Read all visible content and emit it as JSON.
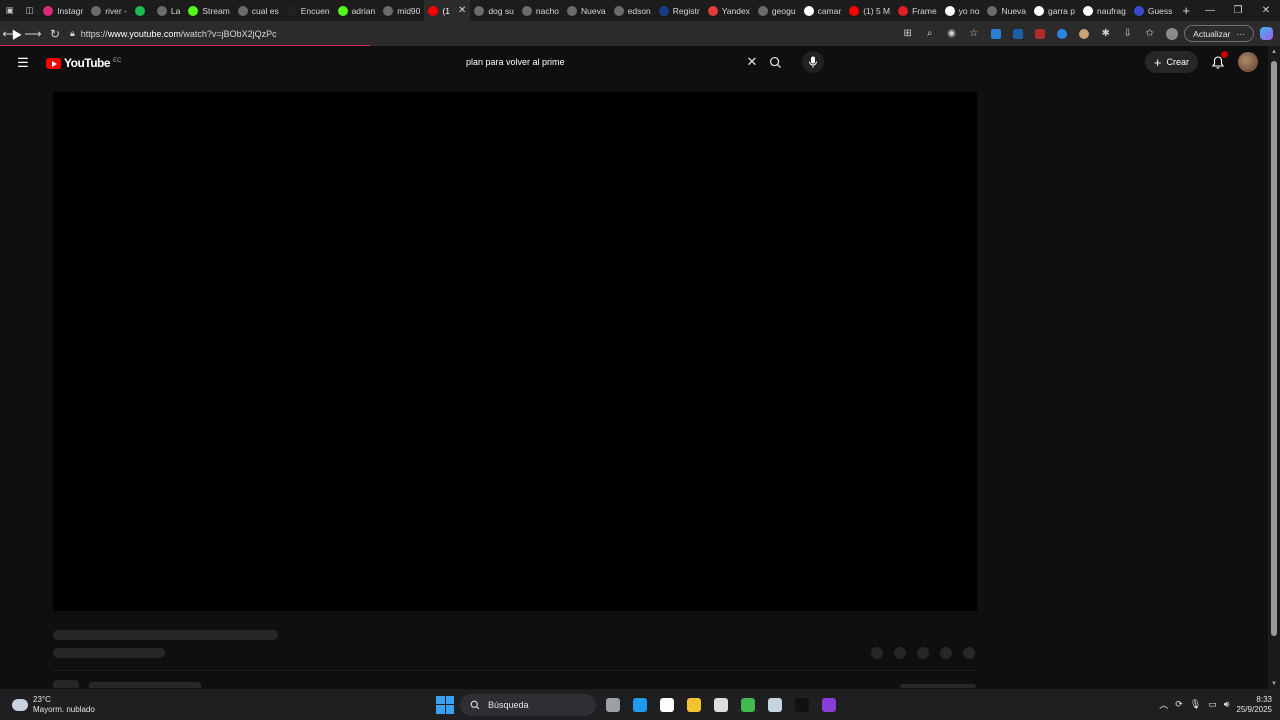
{
  "browser": {
    "tabs": [
      {
        "label": "Instagr",
        "color": "#d62976"
      },
      {
        "label": "river -",
        "color": "#6b6b6b"
      },
      {
        "label": "",
        "color": "#1db954"
      },
      {
        "label": "La",
        "color": "#6b6b6b"
      },
      {
        "label": "Stream",
        "color": "#53fc18"
      },
      {
        "label": "cual es",
        "color": "#6b6b6b"
      },
      {
        "label": "Encuen",
        "color": "#222222"
      },
      {
        "label": "adrian",
        "color": "#53fc18"
      },
      {
        "label": "mid90",
        "color": "#6b6b6b"
      },
      {
        "label": "(1",
        "color": "#ff0000",
        "active": true
      },
      {
        "label": "dog su",
        "color": "#6b6b6b"
      },
      {
        "label": "nacho",
        "color": "#6b6b6b"
      },
      {
        "label": "Nueva",
        "color": "#6b6b6b"
      },
      {
        "label": "edson",
        "color": "#6b6b6b"
      },
      {
        "label": "Registr",
        "color": "#1a3a8c"
      },
      {
        "label": "Yandex",
        "color": "#e23c3c"
      },
      {
        "label": "geogu",
        "color": "#6b6b6b"
      },
      {
        "label": "camar",
        "color": "#ffffff"
      },
      {
        "label": "(1) 5 M",
        "color": "#ff0000"
      },
      {
        "label": "Frame",
        "color": "#e02020"
      },
      {
        "label": "yo no",
        "color": "#ffffff"
      },
      {
        "label": "Nueva",
        "color": "#6b6b6b"
      },
      {
        "label": "garra p",
        "color": "#ffffff"
      },
      {
        "label": "naufrag",
        "color": "#ffffff"
      },
      {
        "label": "Guess",
        "color": "#3a4ad0"
      }
    ],
    "new_tab_icon": "+",
    "url_prefix": "https://",
    "url_host": "www.youtube.com",
    "url_path": "/watch?v=jBObX2jQzPc",
    "update_label": "Actualizar",
    "update_more": "···"
  },
  "youtube": {
    "logo_text": "YouTube",
    "country_code": "EC",
    "search_query": "plan para volver al prime",
    "create_label": "Crear",
    "notification_badge": "red"
  },
  "taskbar": {
    "temperature": "23°C",
    "weather_desc": "Mayorm. nublado",
    "search_label": "Búsqueda",
    "time": "8:33",
    "date": "25/9/2025",
    "apps": [
      {
        "icon": "task-view-icon",
        "color": "#9aa0a6"
      },
      {
        "icon": "edge-icon",
        "color": "#1f9cf0"
      },
      {
        "icon": "store-icon",
        "color": "#ffffff"
      },
      {
        "icon": "file-explorer-icon",
        "color": "#f2c230"
      },
      {
        "icon": "chrome-icon",
        "color": "#dddddd"
      },
      {
        "icon": "terminal-icon",
        "color": "#3fb950"
      },
      {
        "icon": "steam-icon",
        "color": "#c6d4df"
      },
      {
        "icon": "app-icon",
        "color": "#111111"
      },
      {
        "icon": "purple-app-icon",
        "color": "#8b3dd9"
      }
    ]
  }
}
